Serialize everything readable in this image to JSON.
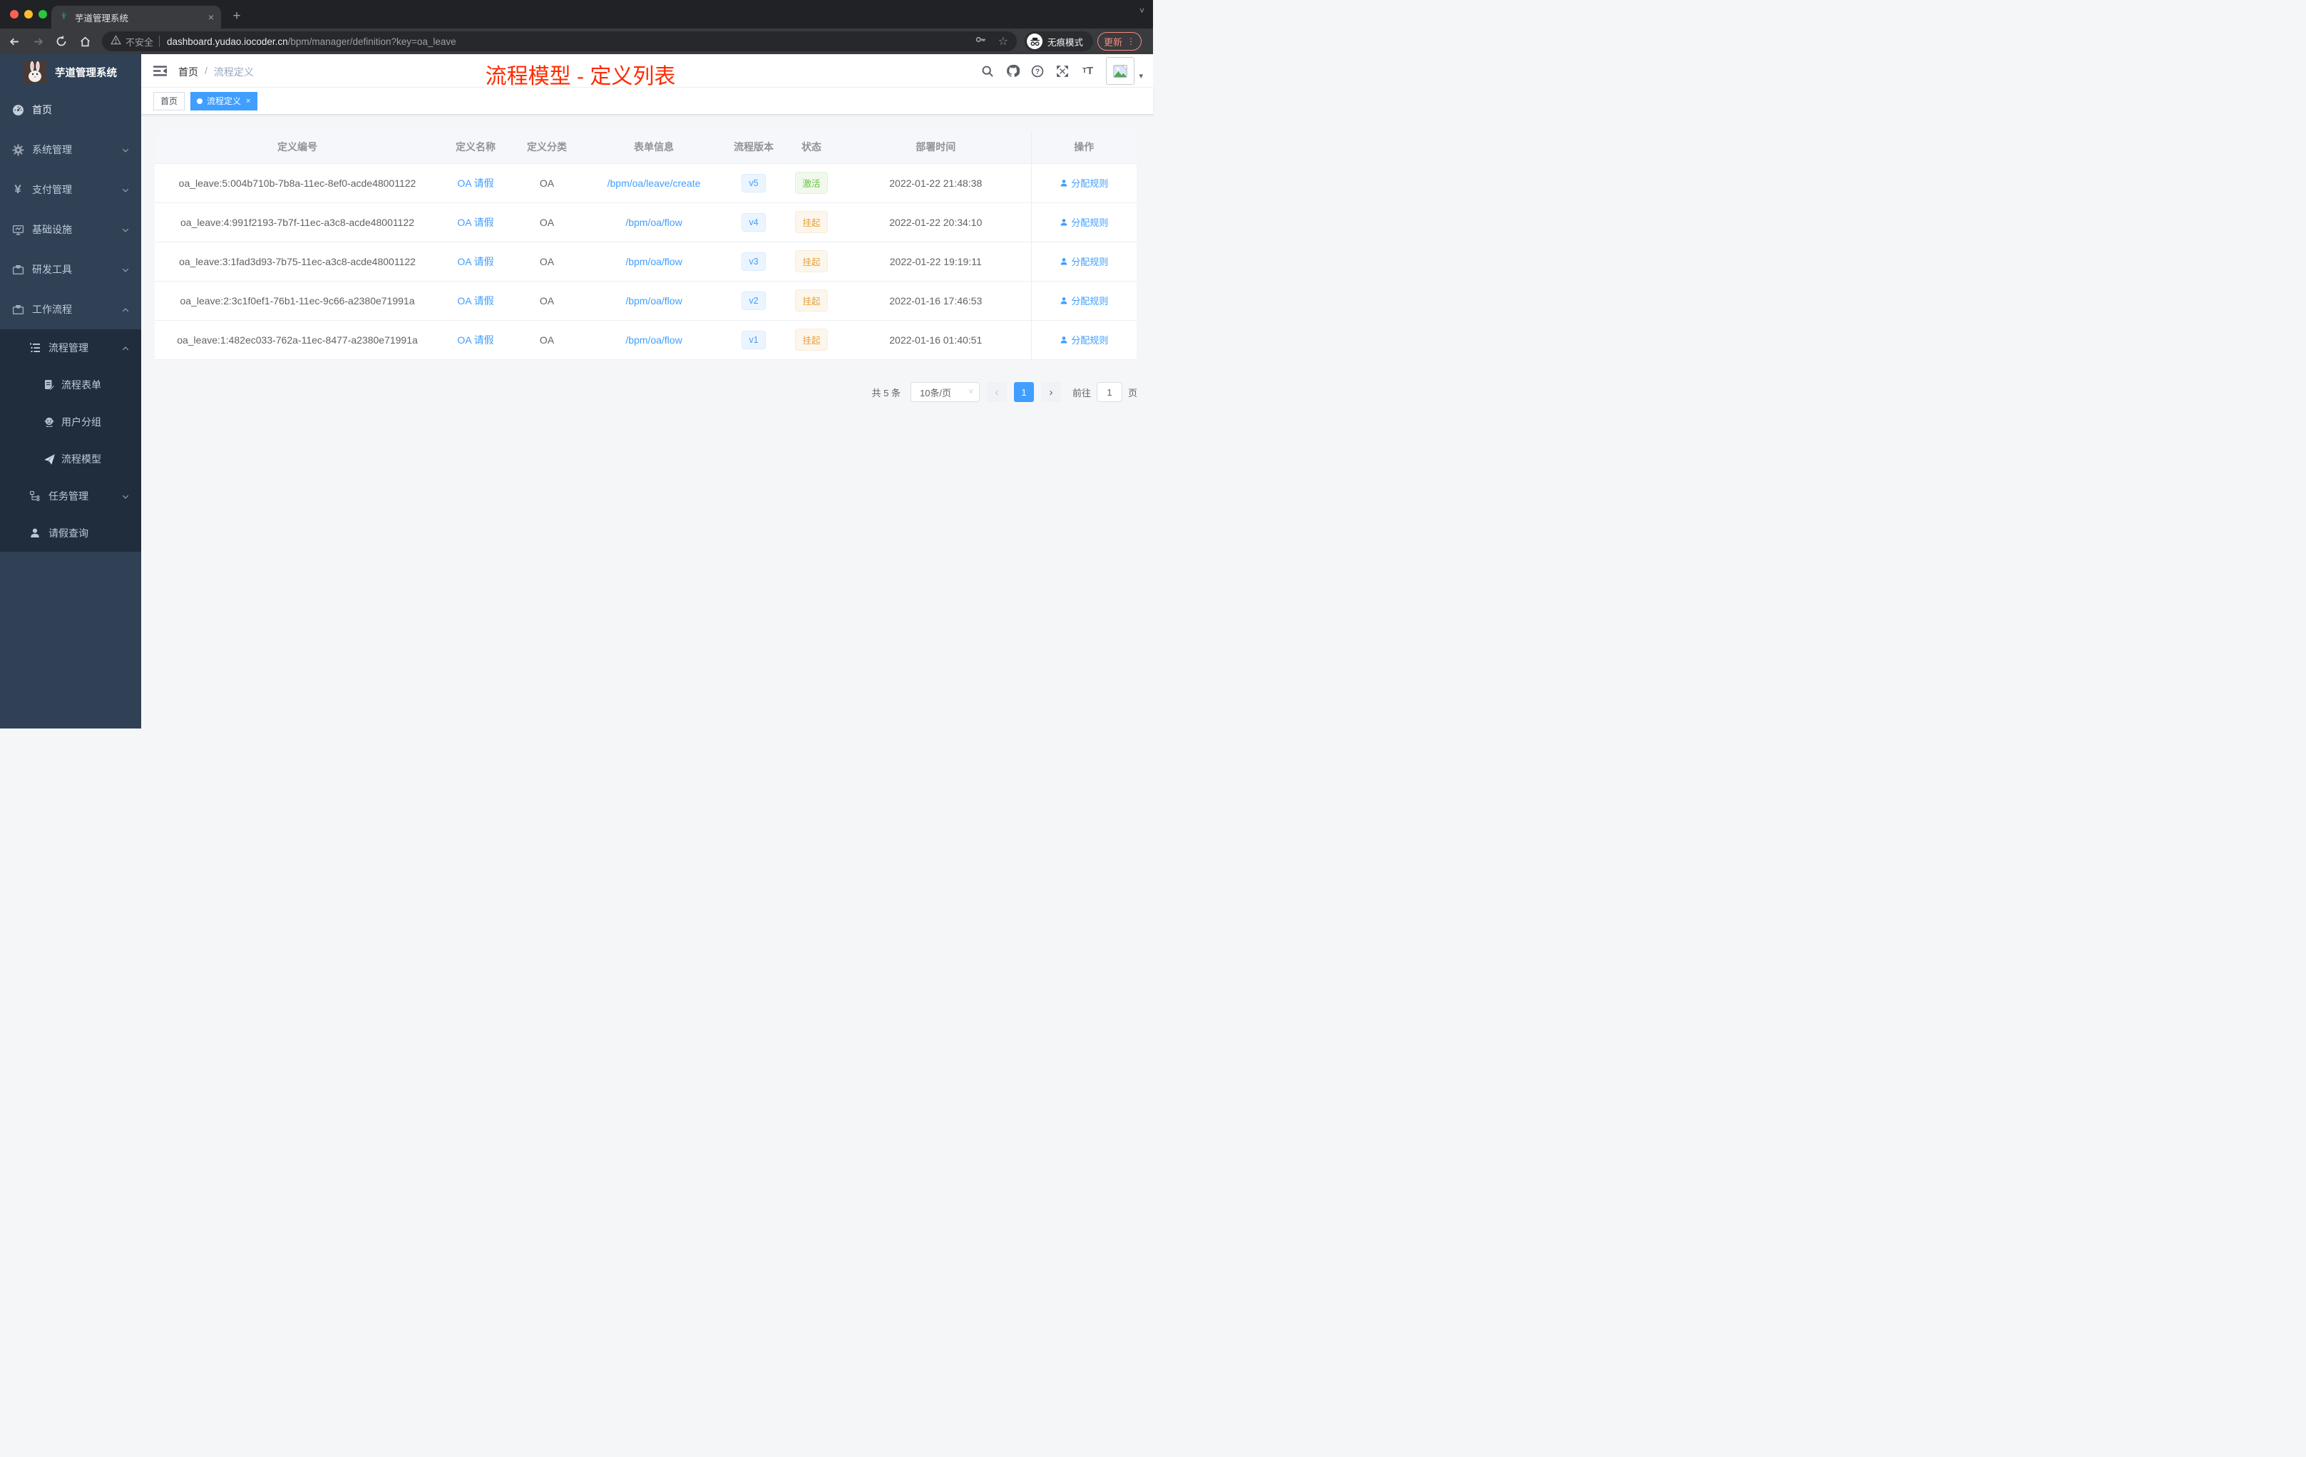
{
  "colors": {
    "accent": "#409eff",
    "annotation": "#ff2a00",
    "success": "#67c23a",
    "warning": "#e6a23c",
    "light-red": "#ff5f57",
    "light-yellow": "#febc2e",
    "light-green": "#28c840"
  },
  "browser": {
    "tab_title": "芋道管理系统",
    "tab_close": "×",
    "new_tab": "+",
    "strip_caret": "˅",
    "security_label": "不安全",
    "url_host": "dashboard.yudao.iocoder.cn",
    "url_path": "/bpm/manager/definition?key=oa_leave",
    "star_icon": "☆",
    "incognito_label": "无痕模式",
    "update_label": "更新",
    "menu_dots": "⋮"
  },
  "sidebar": {
    "logo_title": "芋道管理系统",
    "items": [
      {
        "label": "首页"
      },
      {
        "label": "系统管理",
        "expanded": false
      },
      {
        "label": "支付管理",
        "expanded": false
      },
      {
        "label": "基础设施",
        "expanded": false
      },
      {
        "label": "研发工具",
        "expanded": false
      },
      {
        "label": "工作流程",
        "expanded": true
      },
      {
        "label": "流程管理",
        "expanded": true
      },
      {
        "label": "流程表单"
      },
      {
        "label": "用户分组"
      },
      {
        "label": "流程模型"
      },
      {
        "label": "任务管理",
        "expanded": false
      },
      {
        "label": "请假查询"
      }
    ],
    "yen_glyph": "¥"
  },
  "header": {
    "breadcrumb_home": "首页",
    "breadcrumb_sep": "/",
    "breadcrumb_current": "流程定义",
    "annotation": "流程模型 - 定义列表",
    "font_size_icon": "T",
    "avatar_caret": "▾"
  },
  "tags": [
    {
      "label": "首页",
      "active": false
    },
    {
      "label": "流程定义",
      "active": true,
      "close": "×"
    }
  ],
  "table": {
    "columns": [
      "定义编号",
      "定义名称",
      "定义分类",
      "表单信息",
      "流程版本",
      "状态",
      "部署时间",
      "操作"
    ],
    "rows": [
      {
        "id": "oa_leave:5:004b710b-7b8a-11ec-8ef0-acde48001122",
        "name": "OA 请假",
        "category": "OA",
        "form": "/bpm/oa/leave/create",
        "version": "v5",
        "status": "激活",
        "status_type": "success",
        "time": "2022-01-22 21:48:38",
        "action": "分配规则"
      },
      {
        "id": "oa_leave:4:991f2193-7b7f-11ec-a3c8-acde48001122",
        "name": "OA 请假",
        "category": "OA",
        "form": "/bpm/oa/flow",
        "version": "v4",
        "status": "挂起",
        "status_type": "warning",
        "time": "2022-01-22 20:34:10",
        "action": "分配规则"
      },
      {
        "id": "oa_leave:3:1fad3d93-7b75-11ec-a3c8-acde48001122",
        "name": "OA 请假",
        "category": "OA",
        "form": "/bpm/oa/flow",
        "version": "v3",
        "status": "挂起",
        "status_type": "warning",
        "time": "2022-01-22 19:19:11",
        "action": "分配规则"
      },
      {
        "id": "oa_leave:2:3c1f0ef1-76b1-11ec-9c66-a2380e71991a",
        "name": "OA 请假",
        "category": "OA",
        "form": "/bpm/oa/flow",
        "version": "v2",
        "status": "挂起",
        "status_type": "warning",
        "time": "2022-01-16 17:46:53",
        "action": "分配规则"
      },
      {
        "id": "oa_leave:1:482ec033-762a-11ec-8477-a2380e71991a",
        "name": "OA 请假",
        "category": "OA",
        "form": "/bpm/oa/flow",
        "version": "v1",
        "status": "挂起",
        "status_type": "warning",
        "time": "2022-01-16 01:40:51",
        "action": "分配规则"
      }
    ]
  },
  "pagination": {
    "total_label": "共 5 条",
    "page_size": "10条/页",
    "prev": "‹",
    "next": "›",
    "current_page": "1",
    "goto_label": "前往",
    "goto_value": "1",
    "page_unit": "页",
    "select_caret": "˅"
  }
}
